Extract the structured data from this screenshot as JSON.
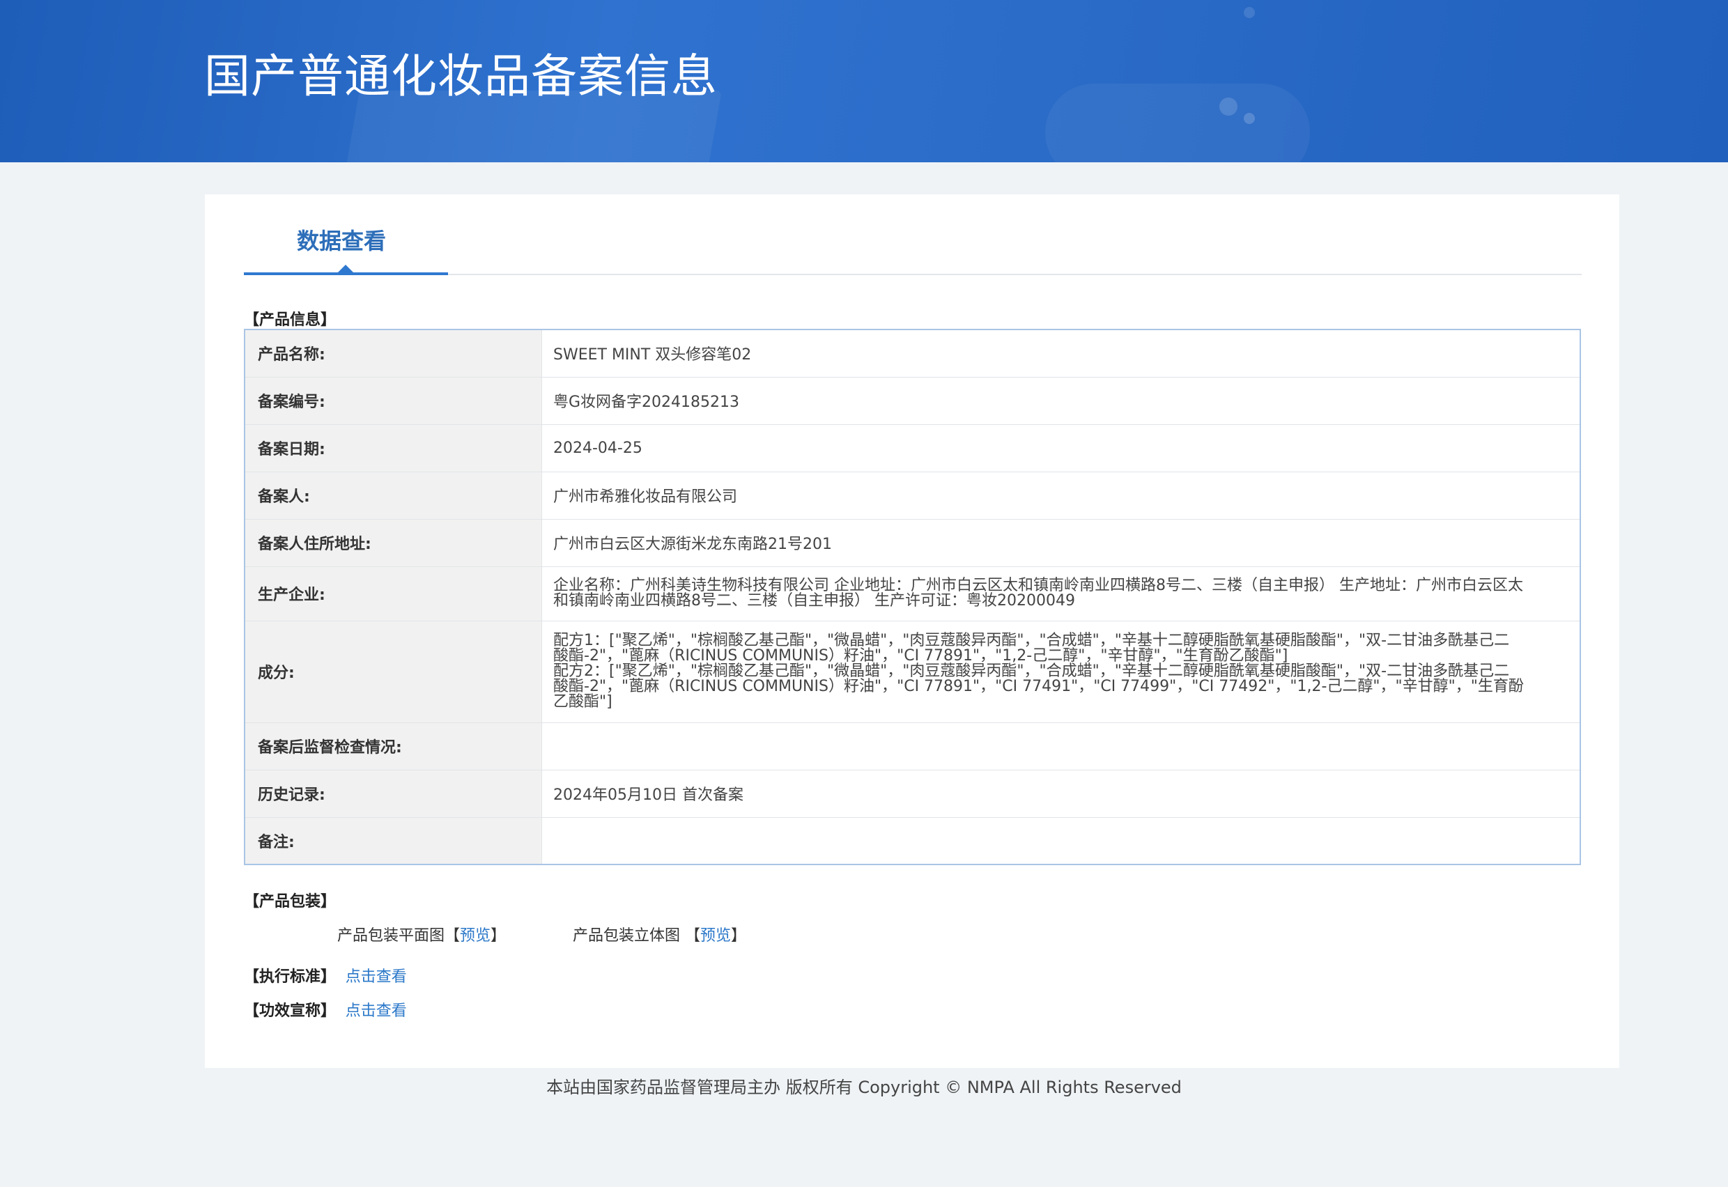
{
  "header": {
    "title": "国产普通化妆品备案信息"
  },
  "tab": {
    "label": "数据查看"
  },
  "product_info": {
    "heading": "【产品信息】",
    "rows": [
      {
        "label": "产品名称:",
        "value": "SWEET MINT 双头修容笔02"
      },
      {
        "label": "备案编号:",
        "value": "粤G妆网备字2024185213"
      },
      {
        "label": "备案日期:",
        "value": "2024-04-25"
      },
      {
        "label": "备案人:",
        "value": "广州市希雅化妆品有限公司"
      },
      {
        "label": "备案人住所地址:",
        "value": "广州市白云区大源街米龙东南路21号201"
      },
      {
        "label": "生产企业:",
        "value": "企业名称：广州科美诗生物科技有限公司 企业地址：广州市白云区太和镇南岭南业四横路8号二、三楼（自主申报） 生产地址：广州市白云区太和镇南岭南业四横路8号二、三楼（自主申报） 生产许可证：粤妆20200049"
      },
      {
        "label": "成分:",
        "value_lines": [
          "配方1：[\"聚乙烯\"，\"棕榈酸乙基己酯\"，\"微晶蜡\"，\"肉豆蔻酸异丙酯\"，\"合成蜡\"，\"辛基十二醇硬脂酰氧基硬脂酸酯\"，\"双-二甘油多酰基己二酸酯-2\"，\"蓖麻（RICINUS COMMUNIS）籽油\"，\"CI 77891\"，\"1,2-己二醇\"，\"辛甘醇\"，\"生育酚乙酸酯\"]",
          "配方2：[\"聚乙烯\"，\"棕榈酸乙基己酯\"，\"微晶蜡\"，\"肉豆蔻酸异丙酯\"，\"合成蜡\"，\"辛基十二醇硬脂酰氧基硬脂酸酯\"，\"双-二甘油多酰基己二酸酯-2\"，\"蓖麻（RICINUS COMMUNIS）籽油\"，\"CI 77891\"，\"CI 77491\"，\"CI 77499\"，\"CI 77492\"，\"1,2-己二醇\"，\"辛甘醇\"，\"生育酚乙酸酯\"]"
        ]
      },
      {
        "label": "备案后监督检查情况:",
        "value": ""
      },
      {
        "label": "历史记录:",
        "value": "2024年05月10日 首次备案"
      },
      {
        "label": "备注:",
        "value": ""
      }
    ]
  },
  "packaging": {
    "heading": "【产品包装】",
    "flat_label": "产品包装平面图",
    "solid_label": "产品包装立体图",
    "bracket_open": "【",
    "bracket_close": "】",
    "preview_link": "预览"
  },
  "standard": {
    "heading": "【执行标准】",
    "link": "点击查看"
  },
  "efficacy": {
    "heading": "【功效宣称】",
    "link": "点击查看"
  },
  "footer": {
    "text": "本站由国家药品监督管理局主办 版权所有 Copyright © NMPA All Rights Reserved"
  }
}
